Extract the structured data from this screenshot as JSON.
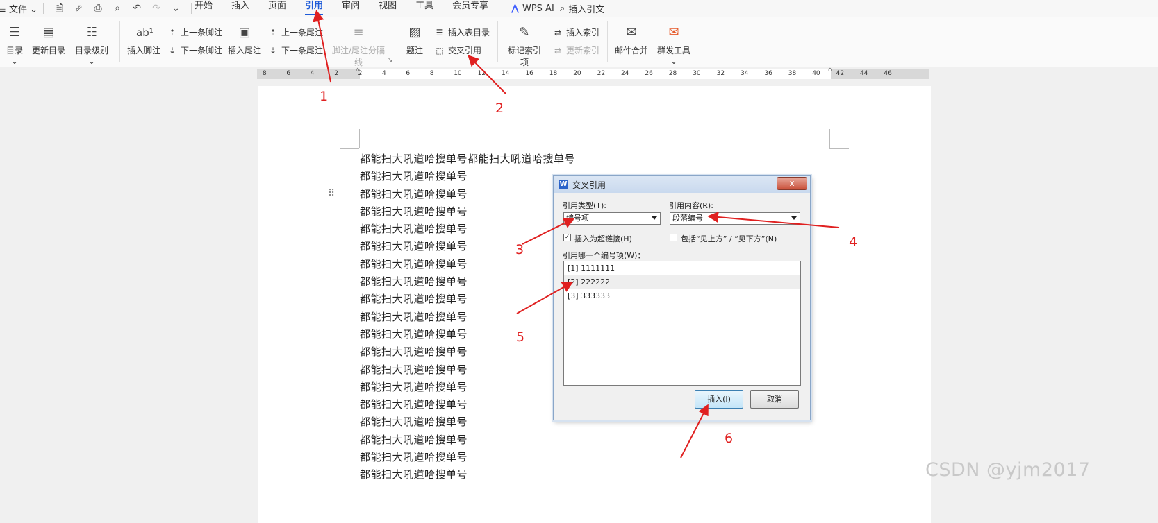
{
  "menu": {
    "file_label": "文件",
    "tabs": [
      {
        "label": "开始"
      },
      {
        "label": "插入"
      },
      {
        "label": "页面"
      },
      {
        "label": "引用"
      },
      {
        "label": "审阅"
      },
      {
        "label": "视图"
      },
      {
        "label": "工具"
      },
      {
        "label": "会员专享"
      }
    ],
    "wps_ai": "WPS AI",
    "insert_citation": "插入引文"
  },
  "ribbon": {
    "toc": "目录",
    "update_toc": "更新目录",
    "toc_level": "目录级别",
    "insert_footnote": "插入脚注",
    "prev_footnote": "上一条脚注",
    "next_footnote": "下一条脚注",
    "insert_endnote": "插入尾注",
    "prev_endnote": "上一条尾注",
    "next_endnote": "下一条尾注",
    "note_separator": "脚注/尾注分隔线",
    "caption": "题注",
    "insert_table_of_figures": "插入表目录",
    "cross_reference": "交叉引用",
    "mark_index_entry": "标记索引项",
    "insert_index": "插入索引",
    "update_index": "更新索引",
    "mail_merge": "邮件合并",
    "group_send": "群发工具"
  },
  "ruler": {
    "labels": [
      "8",
      "6",
      "4",
      "2",
      "2",
      "4",
      "6",
      "8",
      "10",
      "12",
      "14",
      "16",
      "18",
      "20",
      "22",
      "24",
      "26",
      "28",
      "30",
      "32",
      "34",
      "36",
      "38",
      "40",
      "42",
      "44",
      "46"
    ]
  },
  "document": {
    "lines": [
      "都能扫大吼道哈搜单号都能扫大吼道哈搜单号",
      "都能扫大吼道哈搜单号",
      "都能扫大吼道哈搜单号",
      "都能扫大吼道哈搜单号",
      "都能扫大吼道哈搜单号",
      "都能扫大吼道哈搜单号",
      "都能扫大吼道哈搜单号",
      "都能扫大吼道哈搜单号",
      "都能扫大吼道哈搜单号",
      "都能扫大吼道哈搜单号",
      "都能扫大吼道哈搜单号",
      "都能扫大吼道哈搜单号",
      "都能扫大吼道哈搜单号",
      "都能扫大吼道哈搜单号",
      "都能扫大吼道哈搜单号",
      "都能扫大吼道哈搜单号",
      "都能扫大吼道哈搜单号",
      "都能扫大吼道哈搜单号",
      "都能扫大吼道哈搜单号"
    ]
  },
  "dialog": {
    "title": "交叉引用",
    "close": "x",
    "ref_type_label": "引用类型(T):",
    "ref_type_value": "编号项",
    "ref_content_label": "引用内容(R):",
    "ref_content_value": "段落编号",
    "hyperlink_label": "插入为超链接(H)",
    "hyperlink_checked": true,
    "include_label": "包括“见上方” / “见下方”(N)",
    "include_checked": false,
    "which_label": "引用哪一个编号项(W)：",
    "items": [
      {
        "label": "[1] 1111111"
      },
      {
        "label": "[2] 222222"
      },
      {
        "label": "[3] 333333"
      }
    ],
    "insert_button": "插入(I)",
    "cancel_button": "取消"
  },
  "annotations": [
    "1",
    "2",
    "3",
    "4",
    "5",
    "6"
  ],
  "watermark": "CSDN @yjm2017",
  "colors": {
    "accent": "#1e5bd8",
    "annotation": "#e02020"
  }
}
